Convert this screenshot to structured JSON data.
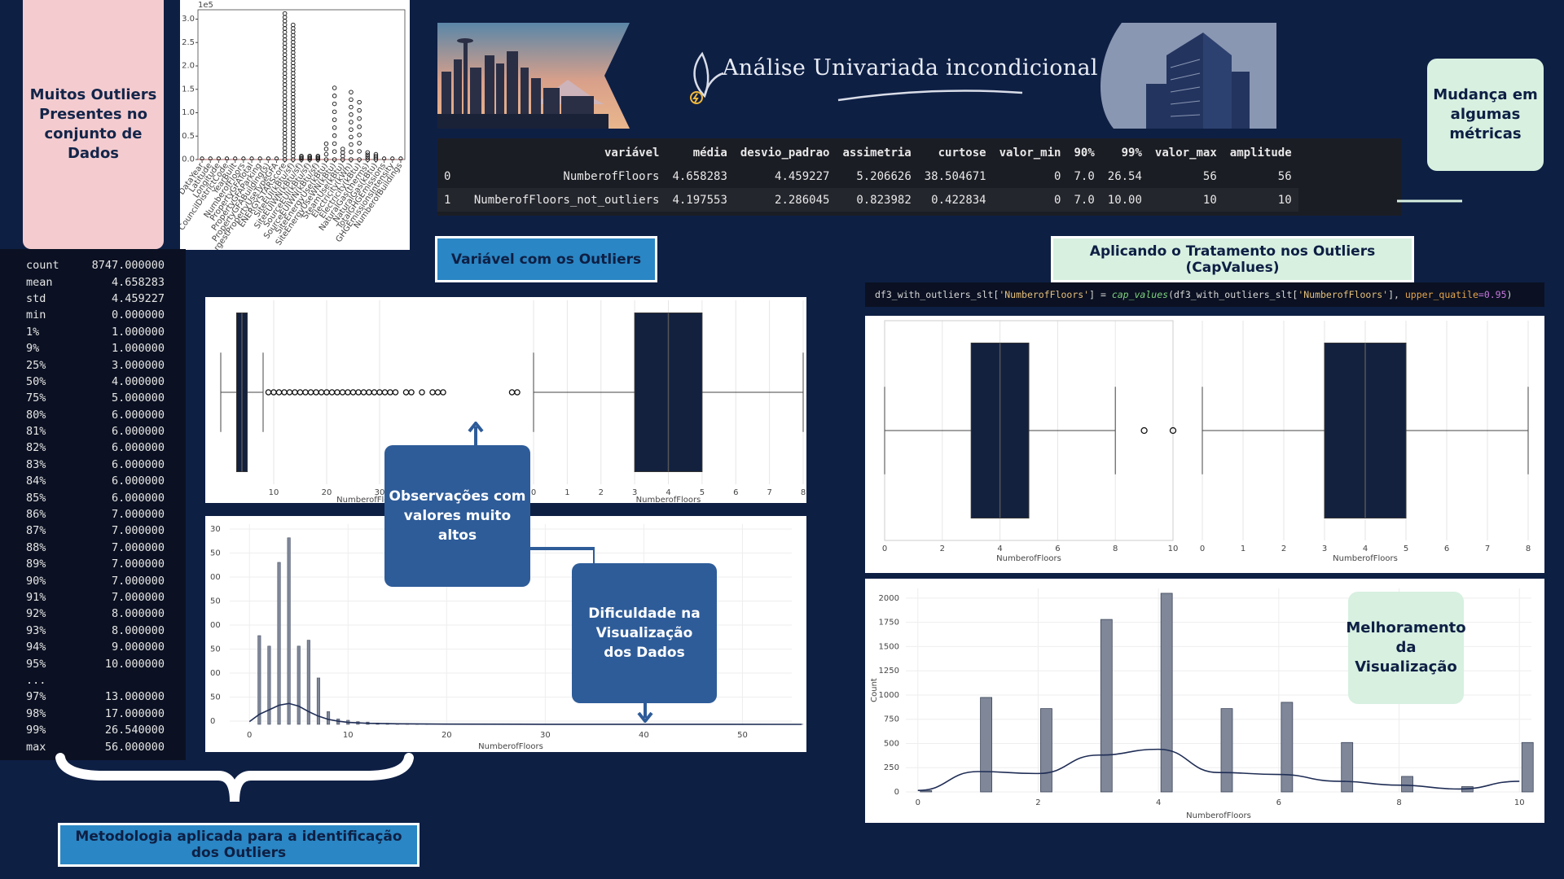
{
  "header": {
    "title": "Análise Univariada incondicional"
  },
  "callouts": {
    "many_outliers": "Muitos Outliers Presentes no conjunto de Dados",
    "metrics_change": "Mudança em algumas métricas",
    "var_with_outliers": "Variável com os Outliers",
    "apply_treatment": "Aplicando o Tratamento nos Outliers (CapValues)",
    "high_values": "Observações com valores muito altos",
    "viz_difficulty": "Dificuldade na Visualização dos Dados",
    "viz_improvement": "Melhoramento da Visualização",
    "methodology": "Metodologia aplicada para a identificação dos Outliers"
  },
  "metrics_table": {
    "columns": [
      "",
      "variável",
      "média",
      "desvio_padrao",
      "assimetria",
      "curtose",
      "valor_min",
      "90%",
      "99%",
      "valor_max",
      "amplitude"
    ],
    "rows": [
      [
        "0",
        "NumberofFloors",
        "4.658283",
        "4.459227",
        "5.206626",
        "38.504671",
        "0",
        "7.0",
        "26.54",
        "56",
        "56"
      ],
      [
        "1",
        "NumberofFloors_not_outliers",
        "4.197553",
        "2.286045",
        "0.823982",
        "0.422834",
        "0",
        "7.0",
        "10.00",
        "10",
        "10"
      ]
    ]
  },
  "code": {
    "p1": "df3_with_outliers_slt[",
    "s1": "'NumberofFloors'",
    "p2": "] = ",
    "fn": "cap_values",
    "p3": "(df3_with_outliers_slt[",
    "s2": "'NumberofFloors'",
    "p4": "], ",
    "kw": "upper_quatile",
    "eq": "=",
    "num": "0.95",
    "p5": ")"
  },
  "describe": {
    "rows": [
      {
        "k": "count",
        "v": "8747.000000"
      },
      {
        "k": "mean",
        "v": "4.658283"
      },
      {
        "k": "std",
        "v": "4.459227"
      },
      {
        "k": "min",
        "v": "0.000000"
      },
      {
        "k": "1%",
        "v": "1.000000"
      },
      {
        "k": "9%",
        "v": "1.000000"
      },
      {
        "k": "25%",
        "v": "3.000000"
      },
      {
        "k": "50%",
        "v": "4.000000"
      },
      {
        "k": "75%",
        "v": "5.000000"
      },
      {
        "k": "80%",
        "v": "6.000000"
      },
      {
        "k": "81%",
        "v": "6.000000"
      },
      {
        "k": "82%",
        "v": "6.000000"
      },
      {
        "k": "83%",
        "v": "6.000000"
      },
      {
        "k": "84%",
        "v": "6.000000"
      },
      {
        "k": "85%",
        "v": "6.000000"
      },
      {
        "k": "86%",
        "v": "7.000000"
      },
      {
        "k": "87%",
        "v": "7.000000"
      },
      {
        "k": "88%",
        "v": "7.000000"
      },
      {
        "k": "89%",
        "v": "7.000000"
      },
      {
        "k": "90%",
        "v": "7.000000"
      },
      {
        "k": "91%",
        "v": "7.000000"
      },
      {
        "k": "92%",
        "v": "8.000000"
      },
      {
        "k": "93%",
        "v": "8.000000"
      },
      {
        "k": "94%",
        "v": "9.000000"
      },
      {
        "k": "95%",
        "v": "10.000000"
      },
      {
        "k": "...",
        "v": ""
      },
      {
        "k": "97%",
        "v": "13.000000"
      },
      {
        "k": "98%",
        "v": "17.000000"
      },
      {
        "k": "99%",
        "v": "26.540000"
      },
      {
        "k": "max",
        "v": "56.000000"
      }
    ]
  },
  "colors": {
    "background": "#0e1f44",
    "box_fill": "#13213f",
    "bar_fill": "#7f8799",
    "accent_blue": "#2a86c4",
    "mint": "#d7f0e0",
    "pink": "#f4cccf"
  },
  "chart_data": [
    {
      "type": "boxplot",
      "id": "all_vars_boxplot",
      "scale_label": "1e5",
      "ylim": [
        0,
        3.2
      ],
      "yticks": [
        "0.0",
        "0.5",
        "1.0",
        "1.5",
        "2.0",
        "2.5",
        "3.0"
      ],
      "categories": [
        "DataYear",
        "Latitude",
        "Longitude",
        "CouncilDistrictCode",
        "YearBuilt",
        "NumberofFloors",
        "PropertyGFATotal",
        "PropertyGFAParking",
        "PropertyGFABuilding(s)",
        "LargestPropertyUseTypeGFA",
        "ENERGYSTARScore",
        "SiteEUI(kBtu/sf)",
        "SiteEUIWN(kBtu/sf)",
        "SourceEUI(kBtu/sf)",
        "SourceEUIWN(kBtu/sf)",
        "SiteEnergyUse(kBtu)",
        "SiteEnergyUseWN(kBtu)",
        "SteamUse(kBtu)",
        "Electricity(kWh)",
        "Electricity(kBtu)",
        "NaturalGas(therms)",
        "NaturalGas(kBtu)",
        "TotalGHGEmissions",
        "GHGEmissionsIntensity",
        "NumberofBuildings"
      ]
    },
    {
      "type": "boxplot",
      "id": "floors_with_outliers",
      "xlabel": "NumberofFloors",
      "xlim": [
        -2,
        58
      ],
      "xticks": [
        10,
        20,
        30
      ],
      "q1": 3,
      "median": 4,
      "q3": 5,
      "whisker_low": 0,
      "whisker_high": 8,
      "outliers": [
        9,
        10,
        11,
        12,
        13,
        14,
        15,
        16,
        17,
        18,
        19,
        20,
        21,
        22,
        23,
        24,
        25,
        26,
        27,
        28,
        29,
        30,
        31,
        32,
        33,
        35,
        36,
        38,
        40,
        41,
        42,
        55,
        56
      ]
    },
    {
      "type": "boxplot",
      "id": "floors_zoom",
      "xlabel": "NumberofFloors",
      "xlim": [
        0,
        8
      ],
      "xticks": [
        0,
        1,
        2,
        3,
        4,
        5,
        6,
        7,
        8
      ],
      "q1": 3,
      "median": 4,
      "q3": 5,
      "whisker_low": 0,
      "whisker_high": 8
    },
    {
      "type": "histogram",
      "id": "floors_hist_raw",
      "xlabel": "NumberofFloors",
      "xlim": [
        -2,
        55
      ],
      "xticks": [
        0,
        10,
        20,
        30,
        40,
        50
      ],
      "yticks_partial": [
        "30",
        "50",
        "00",
        "50",
        "00",
        "50",
        "00",
        "50",
        "0"
      ],
      "x": [
        1,
        2,
        3,
        4,
        5,
        6,
        7,
        8,
        9,
        10,
        11,
        12,
        13,
        14,
        15,
        16,
        17,
        18,
        20,
        21,
        22,
        23,
        24,
        25,
        26,
        27,
        28,
        29,
        30,
        33,
        36,
        37,
        39,
        40,
        42,
        56
      ],
      "values": [
        975,
        860,
        1780,
        2050,
        860,
        925,
        510,
        140,
        60,
        45,
        30,
        25,
        15,
        12,
        10,
        8,
        6,
        5,
        4,
        4,
        3,
        3,
        3,
        2,
        2,
        2,
        2,
        2,
        2,
        2,
        1,
        1,
        1,
        1,
        1,
        1
      ]
    },
    {
      "type": "boxplot",
      "id": "floors_capped_left",
      "xlabel": "NumberofFloors",
      "xlim": [
        0,
        10
      ],
      "xticks": [
        0,
        2,
        4,
        6,
        8,
        10
      ],
      "q1": 3,
      "median": 4,
      "q3": 5,
      "whisker_low": 0,
      "whisker_high": 8,
      "outliers": [
        9,
        10
      ]
    },
    {
      "type": "boxplot",
      "id": "floors_capped_right",
      "xlabel": "NumberofFloors",
      "xlim": [
        0,
        8
      ],
      "xticks": [
        0,
        1,
        2,
        3,
        4,
        5,
        6,
        7,
        8
      ],
      "q1": 3,
      "median": 4,
      "q3": 5,
      "whisker_low": 0,
      "whisker_high": 8
    },
    {
      "type": "histogram",
      "id": "floors_hist_capped",
      "xlabel": "NumberofFloors",
      "ylabel": "Count",
      "xlim": [
        -0.2,
        10.2
      ],
      "ylim": [
        0,
        2100
      ],
      "xticks": [
        0,
        2,
        4,
        6,
        8,
        10
      ],
      "yticks": [
        0,
        250,
        500,
        750,
        1000,
        1250,
        1500,
        1750,
        2000
      ],
      "x": [
        0,
        1,
        2,
        3,
        4,
        5,
        6,
        7,
        8,
        9,
        10
      ],
      "values": [
        15,
        975,
        860,
        1780,
        2050,
        860,
        925,
        510,
        160,
        55,
        510
      ],
      "kde": [
        15,
        210,
        190,
        380,
        440,
        200,
        180,
        110,
        70,
        30,
        110
      ]
    }
  ]
}
